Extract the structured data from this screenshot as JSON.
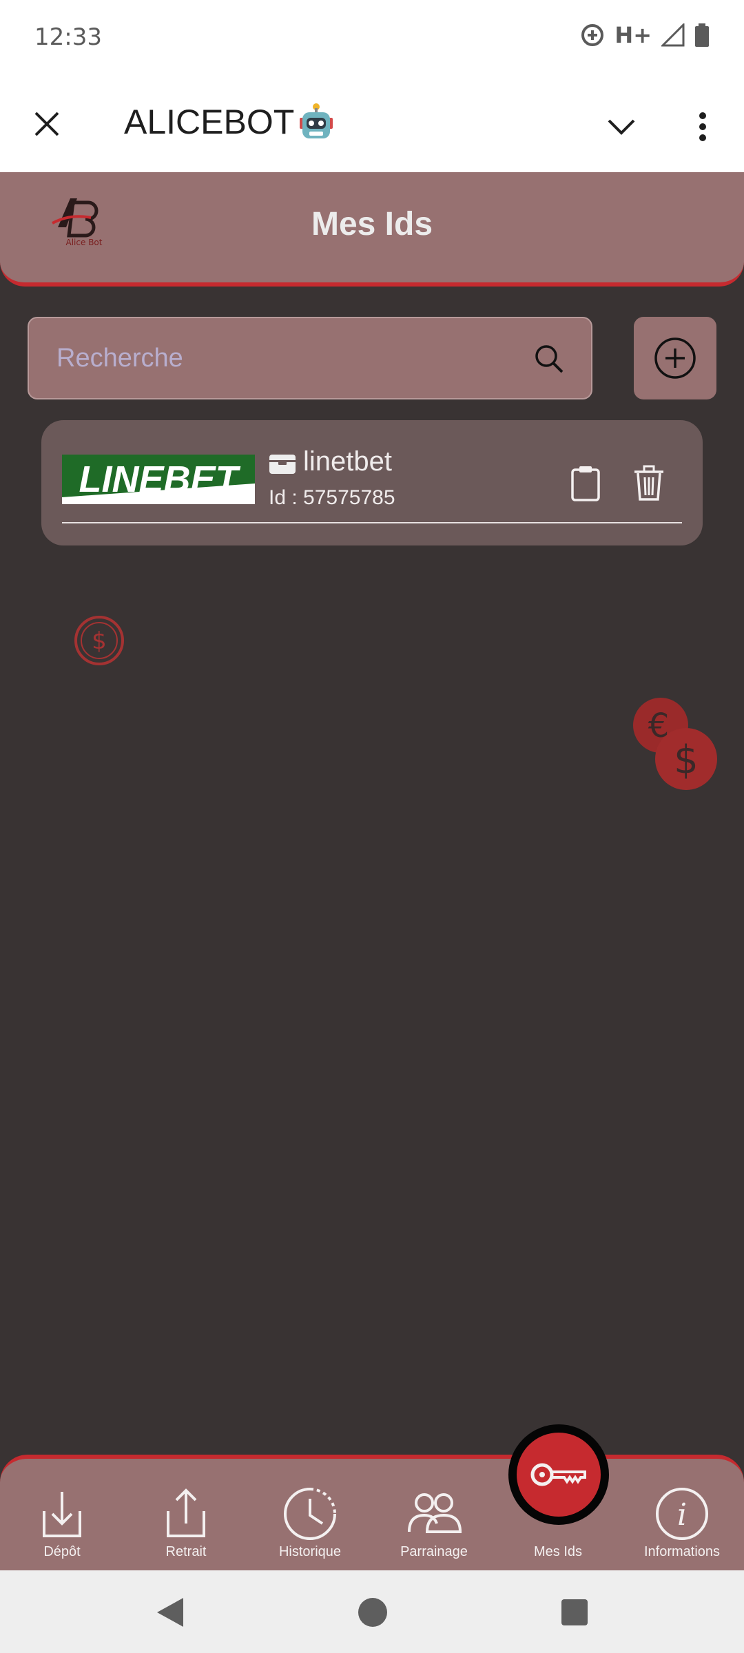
{
  "status_bar": {
    "time": "12:33",
    "network": "H+"
  },
  "app_bar": {
    "title": "ALICEBOT",
    "title_emoji": "robot-face"
  },
  "header": {
    "logo_text": "Alice Bot",
    "logo_initials": "AB",
    "title": "Mes Ids"
  },
  "search": {
    "placeholder": "Recherche",
    "value": ""
  },
  "ids": [
    {
      "brand": "LINEBET",
      "name": "linetbet",
      "id_text": "Id : 57575785",
      "brand_color": "#1f6b27"
    }
  ],
  "bottom_nav": [
    {
      "label": "Dépôt",
      "icon": "download-icon"
    },
    {
      "label": "Retrait",
      "icon": "upload-icon"
    },
    {
      "label": "Historique",
      "icon": "history-icon"
    },
    {
      "label": "Parrainage",
      "icon": "users-icon"
    },
    {
      "label": "Mes Ids",
      "icon": "key-icon",
      "active": true
    },
    {
      "label": "Informations",
      "icon": "info-icon"
    }
  ],
  "colors": {
    "accent": "#c62a2f",
    "panel": "#977171",
    "background": "#393333",
    "card": "#6b5959"
  }
}
